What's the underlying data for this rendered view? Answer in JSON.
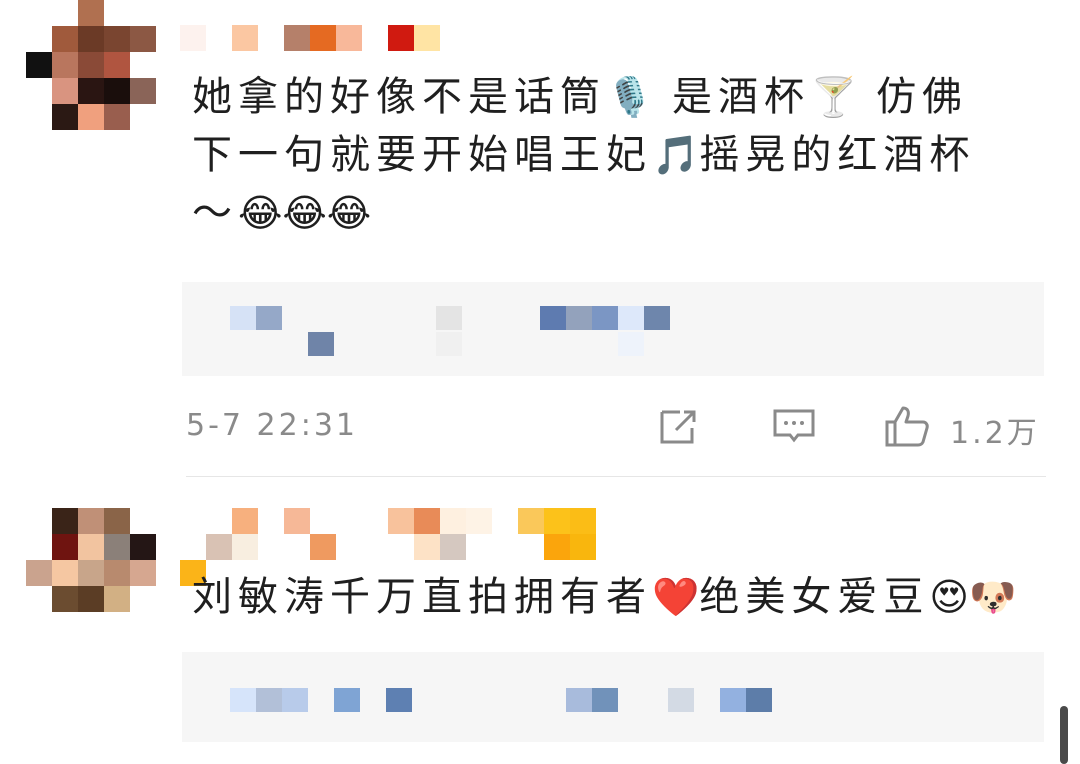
{
  "comments": [
    {
      "text_parts": [
        "她拿的好像不是话筒",
        "是酒杯",
        "仿佛",
        "下一句就要开始唱王妃",
        "摇晃的红酒杯",
        "～"
      ],
      "emojis": [
        "🎙️",
        "🍸",
        "🎵",
        "😂😂😂"
      ],
      "timestamp": "5-7 22:31",
      "likes": "1.2万"
    },
    {
      "text_main": "刘敏涛千万直拍拥有者",
      "text_tail": "绝美女爱豆",
      "emojis": [
        "❤️",
        "😍🐶"
      ]
    }
  ],
  "icons": {
    "share": "share-icon",
    "comment": "comment-icon",
    "like": "thumbs-up-icon"
  },
  "colors": {
    "reply_bg": "#f6f6f6",
    "meta": "#8a8a8a"
  }
}
